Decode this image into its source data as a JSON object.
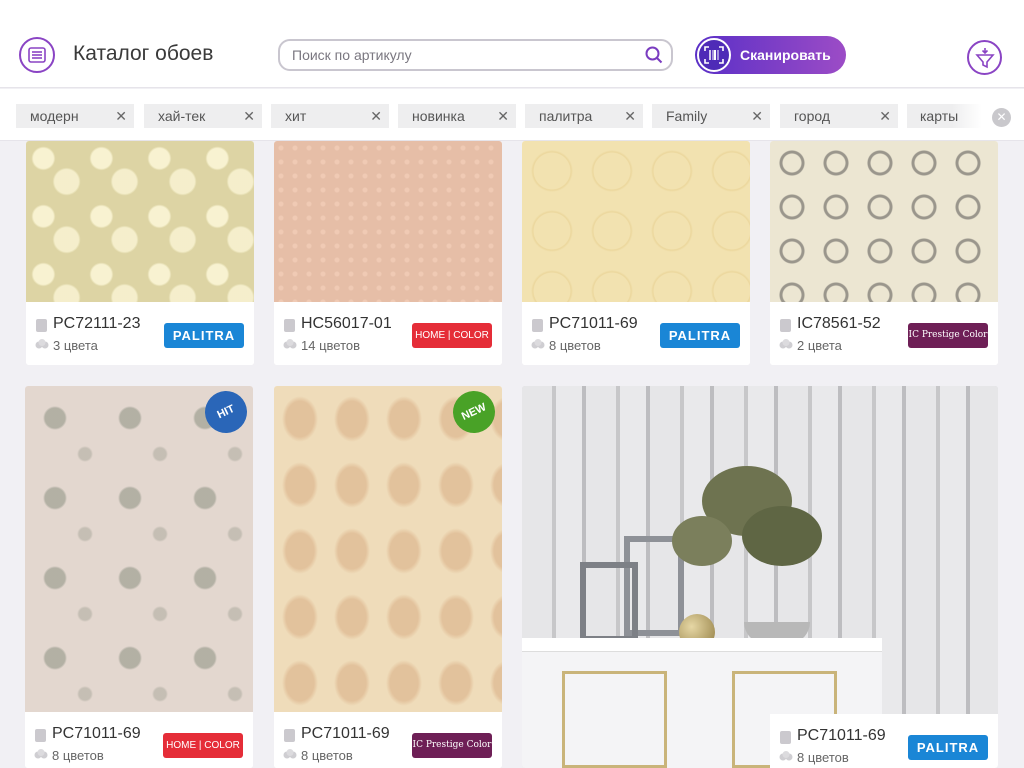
{
  "header": {
    "title": "Каталог обоев",
    "search_placeholder": "Поиск по артикулу",
    "scan_label": "Сканировать"
  },
  "tags": [
    {
      "label": "модерн"
    },
    {
      "label": "хай-тек"
    },
    {
      "label": "хит"
    },
    {
      "label": "новинка"
    },
    {
      "label": "палитра"
    },
    {
      "label": "Family"
    },
    {
      "label": "город"
    },
    {
      "label": "карты"
    }
  ],
  "cards": [
    {
      "sku": "PC72111-23",
      "colors": "3 цвета",
      "brand": "PALITRA"
    },
    {
      "sku": "HC56017-01",
      "colors": "14 цветов",
      "brand": "HOME | COLOR"
    },
    {
      "sku": "PC71011-69",
      "colors": "8 цветов",
      "brand": "PALITRA"
    },
    {
      "sku": "IC78561-52",
      "colors": "2 цвета",
      "brand": "IC Prestige Color"
    },
    {
      "sku": "PC71011-69",
      "colors": "8 цветов",
      "brand": "HOME | COLOR",
      "badge": "HIT"
    },
    {
      "sku": "PC71011-69",
      "colors": "8 цветов",
      "brand": "IC Prestige Color",
      "badge": "NEW"
    },
    {
      "sku": "PC71011-69",
      "colors": "8 цветов",
      "brand": "PALITRA"
    }
  ],
  "icons": {
    "menu": "menu-list-icon",
    "search": "search-icon",
    "scan": "barcode-scan-icon",
    "filter": "funnel-filter-icon",
    "close": "close-icon",
    "sku": "sku-tag-icon",
    "colors": "color-palette-icon"
  },
  "colors": {
    "accent": "#8a44c4",
    "scan_gradient_start": "#5a2fc7",
    "scan_gradient_end": "#9c4cc6",
    "palitra": "#1a86d6",
    "home_color": "#e52d38",
    "prestige": "#6e1f56"
  }
}
